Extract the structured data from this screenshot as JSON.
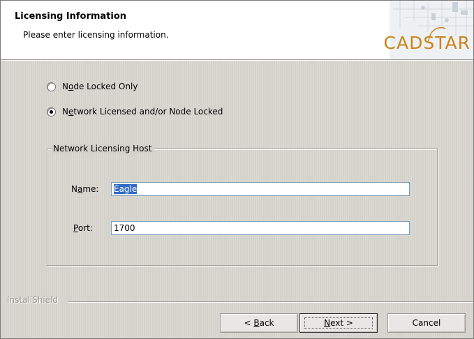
{
  "header": {
    "title": "Licensing Information",
    "subtitle": "Please enter licensing information.",
    "logo_text": "CADSTAR"
  },
  "license_options": [
    {
      "label_before": "N",
      "label_mnemonic": "o",
      "label_after": "de Locked Only",
      "checked": false
    },
    {
      "label_before": "N",
      "label_mnemonic": "e",
      "label_after": "twork Licensed and/or Node Locked",
      "checked": true
    }
  ],
  "network_host": {
    "legend": "Network Licensing Host",
    "name_label_before": "N",
    "name_label_mnemonic": "a",
    "name_label_after": "me:",
    "name_value": "Eagle",
    "port_label_mnemonic": "P",
    "port_label_after": "ort:",
    "port_value": "1700"
  },
  "footer": {
    "brand": "InstallShield",
    "back_prefix": "< ",
    "back_mnemonic": "B",
    "back_rest": "ack",
    "next_mnemonic": "N",
    "next_rest": "ext >",
    "cancel_label": "Cancel"
  },
  "colors": {
    "selection": "#316ac5",
    "logo": "#c8841d",
    "dialog_bg": "#d5d2cc"
  }
}
